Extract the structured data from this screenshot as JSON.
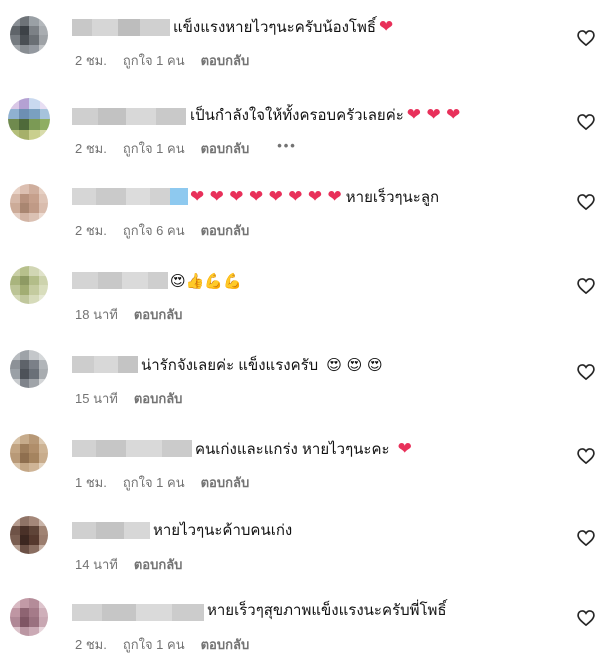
{
  "comments": [
    {
      "text": "แข็งแรงหายไวๆนะครับน้องโพธิ์",
      "emoji_suffix": "❤",
      "time": "2 ชม.",
      "likes": "ถูกใจ 1 คน",
      "reply": "ตอบกลับ",
      "more": ""
    },
    {
      "text": "เป็นกำลังใจให้ทั้งครอบครัวเลยค่ะ",
      "emoji_suffix": "❤ ❤ ❤",
      "time": "2 ชม.",
      "likes": "ถูกใจ 1 คน",
      "reply": "ตอบกลับ",
      "more": "•••"
    },
    {
      "text": "หายเร็วๆนะลูก",
      "emoji_prefix": "❤ ❤ ❤ ❤ ❤ ❤ ❤ ❤",
      "time": "2 ชม.",
      "likes": "ถูกใจ 6 คน",
      "reply": "ตอบกลับ",
      "more": ""
    },
    {
      "text": "",
      "emoji_suffix": "😍👍💪💪",
      "time": "18 นาที",
      "likes": "",
      "reply": "ตอบกลับ",
      "more": ""
    },
    {
      "text": "น่ารักจังเลยค่ะ แข็งแรงครับ",
      "emoji_suffix": "😍 😍 😍",
      "time": "15 นาที",
      "likes": "",
      "reply": "ตอบกลับ",
      "more": ""
    },
    {
      "text": "คนเก่งและแกร่ง หายไวๆนะคะ",
      "emoji_suffix": "❤",
      "time": "1 ชม.",
      "likes": "ถูกใจ 1 คน",
      "reply": "ตอบกลับ",
      "more": ""
    },
    {
      "text": "หายไวๆนะค้าบคนเก่ง",
      "emoji_suffix": "",
      "time": "14 นาที",
      "likes": "",
      "reply": "ตอบกลับ",
      "more": ""
    },
    {
      "text": "หายเร็วๆสุขภาพแข็งแรงนะครับพี่โพธิ์",
      "emoji_suffix": "",
      "time": "2 ชม.",
      "likes": "ถูกใจ 1 คน",
      "reply": "ตอบกลับ",
      "more": ""
    }
  ],
  "icons": {
    "like": "heart-outline-icon",
    "heart_color": "#e8305a"
  }
}
